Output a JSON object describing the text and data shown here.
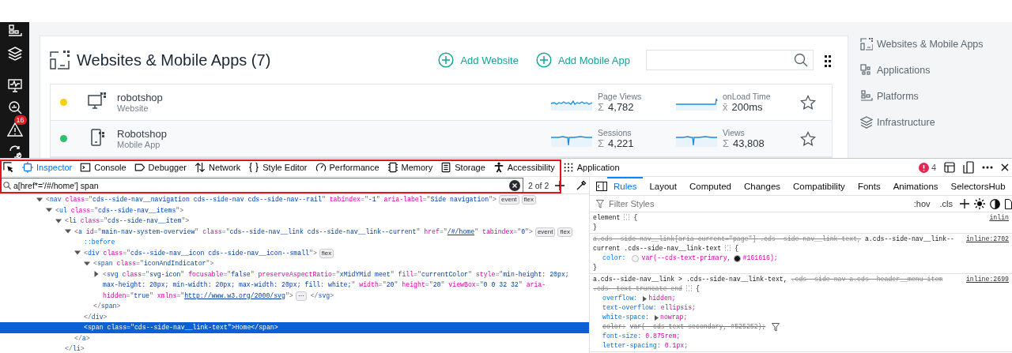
{
  "sidebar": {
    "items": [
      {
        "kind": "platforms"
      },
      {
        "kind": "layers"
      },
      {
        "kind": "divider"
      },
      {
        "kind": "monitor"
      },
      {
        "kind": "analyze"
      },
      {
        "kind": "alert",
        "badge": "16"
      },
      {
        "kind": "automation"
      }
    ]
  },
  "page": {
    "title": "Websites & Mobile Apps (7)",
    "actions": [
      "Add Website",
      "Add Mobile App"
    ],
    "rows": [
      {
        "kind": "website",
        "name": "robotshop",
        "type": "Website",
        "color": "#f5d10c",
        "starred": false,
        "metrics": [
          {
            "label": "Page Views",
            "symbol": "Σ",
            "value": "4,782",
            "kind": "noisy"
          },
          {
            "label": "onLoad Time",
            "symbol": "x̄",
            "value": "200ms",
            "kind": "step"
          }
        ]
      },
      {
        "kind": "mobile",
        "name": "Robotshop",
        "type": "Mobile App",
        "color": "#2fbf71",
        "starred": false,
        "metrics": [
          {
            "label": "Sessions",
            "symbol": "Σ",
            "value": "4,221",
            "kind": "dip"
          },
          {
            "label": "Views",
            "symbol": "Σ",
            "value": "43,808",
            "kind": "dip"
          }
        ]
      }
    ]
  },
  "right_nav": {
    "items": [
      {
        "kind": "websites",
        "label": "Websites & Mobile Apps"
      },
      {
        "kind": "applications",
        "label": "Applications"
      },
      {
        "kind": "platforms",
        "label": "Platforms"
      },
      {
        "kind": "layers",
        "label": "Infrastructure"
      }
    ]
  },
  "devtools": {
    "tools": [
      {
        "kind": "picker",
        "selected": false
      },
      {
        "kind": "inspector",
        "label": "Inspector",
        "selected": true
      },
      {
        "kind": "console",
        "label": "Console",
        "selected": false
      },
      {
        "kind": "debugger",
        "label": "Debugger",
        "selected": false
      },
      {
        "kind": "network",
        "label": "Network",
        "selected": false
      },
      {
        "kind": "style",
        "label": "Style Editor",
        "selected": false
      },
      {
        "kind": "performance",
        "label": "Performance",
        "selected": false
      },
      {
        "kind": "memory",
        "label": "Memory",
        "selected": false
      },
      {
        "kind": "storage",
        "label": "Storage",
        "selected": false
      },
      {
        "kind": "accessibility",
        "label": "Accessibility",
        "selected": false
      },
      {
        "kind": "application",
        "label": "Application",
        "selected": false
      }
    ],
    "error_count": "4",
    "search": {
      "value": "a[href*='/#/home'] span",
      "result": "2 of 2"
    },
    "markup": [
      {
        "selected": false,
        "expanded": true,
        "tokens": [
          {
            "kind": "p",
            "text": "<"
          },
          {
            "kind": "tag",
            "text": "nav"
          },
          {
            "kind": "attr",
            "text": " class"
          },
          {
            "kind": "p",
            "text": "=\""
          },
          {
            "kind": "val",
            "text": "cds--side-nav__navigation cds--side-nav cds--side-nav--rail"
          },
          {
            "kind": "p",
            "text": "\""
          },
          {
            "kind": "attr",
            "text": " tabindex"
          },
          {
            "kind": "p",
            "text": "=\""
          },
          {
            "kind": "val",
            "text": "-1"
          },
          {
            "kind": "p",
            "text": "\""
          },
          {
            "kind": "attr",
            "text": " aria-label"
          },
          {
            "kind": "p",
            "text": "=\""
          },
          {
            "kind": "val",
            "text": "Side navigation"
          },
          {
            "kind": "p",
            "text": "\">"
          },
          {
            "kind": "badge",
            "text": "event"
          },
          {
            "kind": "badge",
            "text": "flex"
          }
        ],
        "children": [
          {
            "selected": false,
            "expanded": true,
            "tokens": [
              {
                "kind": "p",
                "text": "<"
              },
              {
                "kind": "tag",
                "text": "ul"
              },
              {
                "kind": "attr",
                "text": " class"
              },
              {
                "kind": "p",
                "text": "=\""
              },
              {
                "kind": "val",
                "text": "cds--side-nav__items"
              },
              {
                "kind": "p",
                "text": "\">"
              }
            ],
            "children": [
              {
                "selected": false,
                "expanded": true,
                "tokens": [
                  {
                    "kind": "p",
                    "text": "<"
                  },
                  {
                    "kind": "tag",
                    "text": "li"
                  },
                  {
                    "kind": "attr",
                    "text": " class"
                  },
                  {
                    "kind": "p",
                    "text": "=\""
                  },
                  {
                    "kind": "val",
                    "text": "cds--side-nav__item"
                  },
                  {
                    "kind": "p",
                    "text": "\">"
                  }
                ],
                "children": [
                  {
                    "selected": false,
                    "expanded": true,
                    "tokens": [
                      {
                        "kind": "p",
                        "text": "<"
                      },
                      {
                        "kind": "tag",
                        "text": "a"
                      },
                      {
                        "kind": "attr",
                        "text": " id"
                      },
                      {
                        "kind": "p",
                        "text": "=\""
                      },
                      {
                        "kind": "val",
                        "text": "main-nav-system-overview"
                      },
                      {
                        "kind": "p",
                        "text": "\""
                      },
                      {
                        "kind": "attr",
                        "text": " class"
                      },
                      {
                        "kind": "p",
                        "text": "=\""
                      },
                      {
                        "kind": "val",
                        "text": "cds--side-nav__link cds--side-nav__link--current"
                      },
                      {
                        "kind": "p",
                        "text": "\""
                      },
                      {
                        "kind": "attr",
                        "text": " href"
                      },
                      {
                        "kind": "p",
                        "text": "=\""
                      },
                      {
                        "kind": "link",
                        "text": "/#/home"
                      },
                      {
                        "kind": "p",
                        "text": "\""
                      },
                      {
                        "kind": "attr",
                        "text": " tabindex"
                      },
                      {
                        "kind": "p",
                        "text": "=\""
                      },
                      {
                        "kind": "val",
                        "text": "0"
                      },
                      {
                        "kind": "p",
                        "text": "\">"
                      },
                      {
                        "kind": "badge",
                        "text": "event"
                      },
                      {
                        "kind": "badge",
                        "text": "flex"
                      }
                    ],
                    "children": [
                      {
                        "selected": false,
                        "tokens": [
                          {
                            "kind": "pseudo",
                            "text": "::before"
                          }
                        ]
                      },
                      {
                        "selected": false,
                        "expanded": true,
                        "tokens": [
                          {
                            "kind": "p",
                            "text": "<"
                          },
                          {
                            "kind": "tag",
                            "text": "div"
                          },
                          {
                            "kind": "attr",
                            "text": " class"
                          },
                          {
                            "kind": "p",
                            "text": "=\""
                          },
                          {
                            "kind": "val",
                            "text": "cds--side-nav__icon cds--side-nav__icon--small"
                          },
                          {
                            "kind": "p",
                            "text": "\">"
                          },
                          {
                            "kind": "badge",
                            "text": "flex"
                          }
                        ],
                        "children": [
                          {
                            "selected": false,
                            "expanded": true,
                            "tokens": [
                              {
                                "kind": "p",
                                "text": "<"
                              },
                              {
                                "kind": "tag",
                                "text": "span"
                              },
                              {
                                "kind": "attr",
                                "text": " class"
                              },
                              {
                                "kind": "p",
                                "text": "=\""
                              },
                              {
                                "kind": "val",
                                "text": "iconAndIndicator"
                              },
                              {
                                "kind": "p",
                                "text": "\">"
                              }
                            ],
                            "children": [
                              {
                                "selected": false,
                                "expanded": false,
                                "tokens": [
                                  {
                                    "kind": "p",
                                    "text": "<"
                                  },
                                  {
                                    "kind": "tag",
                                    "text": "svg"
                                  },
                                  {
                                    "kind": "attr",
                                    "text": " class"
                                  },
                                  {
                                    "kind": "p",
                                    "text": "=\""
                                  },
                                  {
                                    "kind": "val",
                                    "text": "svg-icon"
                                  },
                                  {
                                    "kind": "p",
                                    "text": "\""
                                  },
                                  {
                                    "kind": "attr",
                                    "text": " focusable"
                                  },
                                  {
                                    "kind": "p",
                                    "text": "=\""
                                  },
                                  {
                                    "kind": "val",
                                    "text": "false"
                                  },
                                  {
                                    "kind": "p",
                                    "text": "\""
                                  },
                                  {
                                    "kind": "attr",
                                    "text": " preserveAspectRatio"
                                  },
                                  {
                                    "kind": "p",
                                    "text": "=\""
                                  },
                                  {
                                    "kind": "val",
                                    "text": "xMidYMid meet"
                                  },
                                  {
                                    "kind": "p",
                                    "text": "\""
                                  },
                                  {
                                    "kind": "attr",
                                    "text": " fill"
                                  },
                                  {
                                    "kind": "p",
                                    "text": "=\""
                                  },
                                  {
                                    "kind": "val",
                                    "text": "currentColor"
                                  },
                                  {
                                    "kind": "p",
                                    "text": "\""
                                  },
                                  {
                                    "kind": "attr",
                                    "text": " style"
                                  },
                                  {
                                    "kind": "p",
                                    "text": "=\""
                                  },
                                  {
                                    "kind": "val",
                                    "text": "min-height: 20px; max-height: 20px; min-width: 20px; max-width: 20px; fill: white;"
                                  },
                                  {
                                    "kind": "p",
                                    "text": "\""
                                  },
                                  {
                                    "kind": "attr",
                                    "text": " width"
                                  },
                                  {
                                    "kind": "p",
                                    "text": "=\""
                                  },
                                  {
                                    "kind": "val",
                                    "text": "20"
                                  },
                                  {
                                    "kind": "p",
                                    "text": "\""
                                  },
                                  {
                                    "kind": "attr",
                                    "text": " height"
                                  },
                                  {
                                    "kind": "p",
                                    "text": "=\""
                                  },
                                  {
                                    "kind": "val",
                                    "text": "20"
                                  },
                                  {
                                    "kind": "p",
                                    "text": "\""
                                  },
                                  {
                                    "kind": "attr",
                                    "text": " viewBox"
                                  },
                                  {
                                    "kind": "p",
                                    "text": "=\""
                                  },
                                  {
                                    "kind": "val",
                                    "text": "0 0 32 32"
                                  },
                                  {
                                    "kind": "p",
                                    "text": "\""
                                  },
                                  {
                                    "kind": "attr",
                                    "text": " aria-hidden"
                                  },
                                  {
                                    "kind": "p",
                                    "text": "=\""
                                  },
                                  {
                                    "kind": "val",
                                    "text": "true"
                                  },
                                  {
                                    "kind": "p",
                                    "text": "\""
                                  },
                                  {
                                    "kind": "attr",
                                    "text": " xmlns"
                                  },
                                  {
                                    "kind": "p",
                                    "text": "=\""
                                  },
                                  {
                                    "kind": "link",
                                    "text": "http://www.w3.org/2000/svg"
                                  },
                                  {
                                    "kind": "p",
                                    "text": "\">"
                                  },
                                  {
                                    "kind": "badge",
                                    "text": "⋯"
                                  },
                                  {
                                    "kind": "p",
                                    "text": " </"
                                  },
                                  {
                                    "kind": "tag",
                                    "text": "svg"
                                  },
                                  {
                                    "kind": "p",
                                    "text": ">"
                                  }
                                ]
                              }
                            ],
                            "close": [
                              {
                                "kind": "p",
                                "text": "</"
                              },
                              {
                                "kind": "tag",
                                "text": "span"
                              },
                              {
                                "kind": "p",
                                "text": ">"
                              }
                            ]
                          }
                        ],
                        "close": [
                          {
                            "kind": "p",
                            "text": "</"
                          },
                          {
                            "kind": "tag",
                            "text": "div"
                          },
                          {
                            "kind": "p",
                            "text": ">"
                          }
                        ]
                      },
                      {
                        "selected": true,
                        "tokens": [
                          {
                            "kind": "p",
                            "text": "<"
                          },
                          {
                            "kind": "tag",
                            "text": "span"
                          },
                          {
                            "kind": "attr",
                            "text": " class"
                          },
                          {
                            "kind": "p",
                            "text": "=\""
                          },
                          {
                            "kind": "val",
                            "text": "cds--side-nav__link-text"
                          },
                          {
                            "kind": "p",
                            "text": "\">"
                          },
                          {
                            "kind": "text",
                            "text": "Home"
                          },
                          {
                            "kind": "p",
                            "text": "</"
                          },
                          {
                            "kind": "tag",
                            "text": "span"
                          },
                          {
                            "kind": "p",
                            "text": ">"
                          }
                        ]
                      }
                    ],
                    "close": [
                      {
                        "kind": "p",
                        "text": "</"
                      },
                      {
                        "kind": "tag",
                        "text": "a"
                      },
                      {
                        "kind": "p",
                        "text": ">"
                      }
                    ]
                  }
                ],
                "close": [
                  {
                    "kind": "p",
                    "text": "</"
                  },
                  {
                    "kind": "tag",
                    "text": "li"
                  },
                  {
                    "kind": "p",
                    "text": ">"
                  }
                ]
              }
            ]
          }
        ]
      }
    ],
    "rules_tabs": [
      {
        "label": "Rules",
        "selected": true
      },
      {
        "label": "Layout",
        "selected": false
      },
      {
        "label": "Computed",
        "selected": false
      },
      {
        "label": "Changes",
        "selected": false
      },
      {
        "label": "Compatibility",
        "selected": false
      },
      {
        "label": "Fonts",
        "selected": false
      },
      {
        "label": "Animations",
        "selected": false
      },
      {
        "label": "SelectorsHub",
        "selected": false
      }
    ],
    "filter": {
      "placeholder": "Filter Styles"
    },
    "rule_buttons": [
      ":hov",
      ".cls"
    ],
    "rules": [
      {
        "selectors": [
          {
            "text": "element",
            "matched": true
          }
        ],
        "open": "{",
        "close": "}",
        "source": "inlin"
      },
      {
        "selectors": [
          {
            "text": "a.cds--side-nav__link[aria-current=\"page\"] .cds--side-nav__link-text,",
            "matched": false
          },
          {
            "text": "a.cds--side-nav__link--current .cds--side-nav__link-text",
            "matched": true
          }
        ],
        "open": "{",
        "close": "}",
        "source": "inline:2702",
        "declarations": [
          {
            "name": "color:",
            "value": [
              {
                "color": "#f4f4f4"
              },
              {
                "text": "var(--cds-text-primary,"
              },
              {
                "color": "#161616"
              },
              {
                "text": "#161616);"
              }
            ],
            "overridden": false
          }
        ]
      },
      {
        "selectors": [
          {
            "text": "a.cds--side-nav__link > .cds--side-nav__link-text,",
            "matched": true
          },
          {
            "text": ".cds--side-nav a.cds--header__menu-item .cds--text-truncate-end",
            "matched": false
          }
        ],
        "open": "{",
        "source": "inline:2699",
        "declarations": [
          {
            "name": "overflow:",
            "value": "hidden;",
            "overridden": false,
            "expandable": true
          },
          {
            "name": "text-overflow:",
            "value": "ellipsis;",
            "overridden": false
          },
          {
            "name": "white-space:",
            "value": "nowrap;",
            "overridden": false,
            "expandable": true
          },
          {
            "name": "color:",
            "value": "var(--cds-text-secondary, #525252);",
            "overridden": true,
            "filter": true
          },
          {
            "name": "font-size:",
            "value": "0.875rem;",
            "overridden": false
          },
          {
            "name": "letter-spacing:",
            "value": "0.1px;",
            "overridden": false
          }
        ]
      }
    ]
  }
}
